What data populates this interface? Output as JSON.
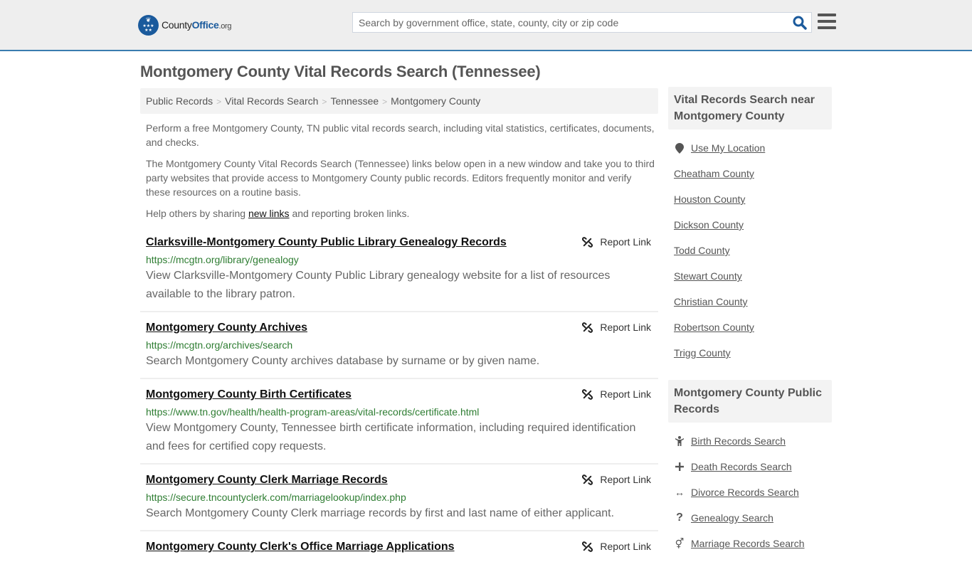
{
  "header": {
    "logo": {
      "part1": "County",
      "part2": "Office",
      "part3": ".org"
    },
    "search_placeholder": "Search by government office, state, county, city or zip code",
    "search_value": ""
  },
  "page_title": "Montgomery County Vital Records Search (Tennessee)",
  "breadcrumb": [
    {
      "label": "Public Records"
    },
    {
      "label": "Vital Records Search"
    },
    {
      "label": "Tennessee"
    },
    {
      "label": "Montgomery County"
    }
  ],
  "breadcrumb_separator": ">",
  "intro": {
    "p1": "Perform a free Montgomery County, TN public vital records search, including vital statistics, certificates, documents, and checks.",
    "p2": "The Montgomery County Vital Records Search (Tennessee) links below open in a new window and take you to third party websites that provide access to Montgomery County public records. Editors frequently monitor and verify these resources on a routine basis.",
    "p3_before": "Help others by sharing ",
    "p3_link": "new links",
    "p3_after": " and reporting broken links."
  },
  "report_link_label": "Report Link",
  "results": [
    {
      "title": "Clarksville-Montgomery County Public Library Genealogy Records",
      "url": "https://mcgtn.org/library/genealogy",
      "description": "View Clarksville-Montgomery County Public Library genealogy website for a list of resources available to the library patron."
    },
    {
      "title": "Montgomery County Archives",
      "url": "https://mcgtn.org/archives/search",
      "description": "Search Montgomery County archives database by surname or by given name."
    },
    {
      "title": "Montgomery County Birth Certificates",
      "url": "https://www.tn.gov/health/health-program-areas/vital-records/certificate.html",
      "description": "View Montgomery County, Tennessee birth certificate information, including required identification and fees for certified copy requests."
    },
    {
      "title": "Montgomery County Clerk Marriage Records",
      "url": "https://secure.tncountyclerk.com/marriagelookup/index.php",
      "description": "Search Montgomery County Clerk marriage records by first and last name of either applicant."
    },
    {
      "title": "Montgomery County Clerk's Office Marriage Applications",
      "url": "",
      "description": ""
    }
  ],
  "sidebar": {
    "nearby": {
      "heading": "Vital Records Search near Montgomery County",
      "use_location": "Use My Location",
      "counties": [
        "Cheatham County",
        "Houston County",
        "Dickson County",
        "Todd County",
        "Stewart County",
        "Christian County",
        "Robertson County",
        "Trigg County"
      ]
    },
    "public_records": {
      "heading": "Montgomery County Public Records",
      "items": [
        {
          "label": "Birth Records Search",
          "icon": "child-icon"
        },
        {
          "label": "Death Records Search",
          "icon": "plus-icon"
        },
        {
          "label": "Divorce Records Search",
          "icon": "arrows-horizontal-icon"
        },
        {
          "label": "Genealogy Search",
          "icon": "question-icon"
        },
        {
          "label": "Marriage Records Search",
          "icon": "venus-mars-icon"
        }
      ]
    }
  },
  "colors": {
    "brand_blue": "#1a5a9c",
    "header_border": "#3a7caf",
    "url_green": "#2e7d32"
  }
}
